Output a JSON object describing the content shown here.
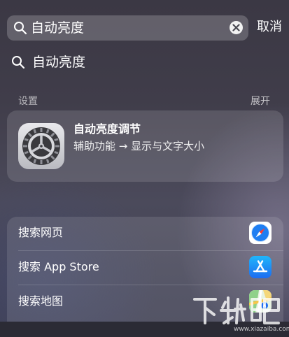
{
  "search": {
    "query": "自动亮度",
    "cancel_label": "取消"
  },
  "suggestion": {
    "text": "自动亮度"
  },
  "settings_section": {
    "header": "设置",
    "expand_label": "展开",
    "result": {
      "title": "自动亮度调节",
      "subtitle": "辅助功能 → 显示与文字大小",
      "icon": "settings-gear-icon"
    }
  },
  "web_search": {
    "items": [
      {
        "label": "搜索网页",
        "icon": "safari-icon"
      },
      {
        "label": "搜索 App Store",
        "icon": "app-store-icon"
      },
      {
        "label": "搜索地图",
        "icon": "maps-icon"
      }
    ]
  },
  "watermark": {
    "logo_text": "下载吧",
    "domain": "www.xiazaiba.com"
  },
  "colors": {
    "app_store_blue": "#1e8cf5",
    "safari_blue": "#1f7ef2",
    "gear_dark": "#3a3a3e"
  }
}
